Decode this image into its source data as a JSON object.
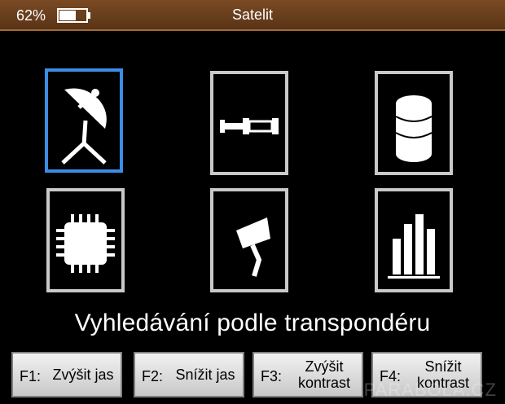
{
  "status": {
    "battery_percent": "62%",
    "battery_level": 0.62,
    "title": "Satelit"
  },
  "tiles": [
    {
      "icon": "satellite-dish-icon",
      "selected": true
    },
    {
      "icon": "telescope-icon",
      "selected": false
    },
    {
      "icon": "database-icon",
      "selected": false
    },
    {
      "icon": "chip-icon",
      "selected": false
    },
    {
      "icon": "camera-icon",
      "selected": false
    },
    {
      "icon": "bar-chart-icon",
      "selected": false
    }
  ],
  "caption": "Vyhledávání podle transpondéru",
  "function_keys": [
    {
      "key": "F1:",
      "label": "Zvýšit jas"
    },
    {
      "key": "F2:",
      "label": "Snížit jas"
    },
    {
      "key": "F3:",
      "label": "Zvýšit kontrast"
    },
    {
      "key": "F4:",
      "label": "Snížit kontrast"
    }
  ],
  "watermark": "PARABOLA.CZ",
  "colors": {
    "status_bar": "#6b3f1e",
    "selection": "#3a8ee6",
    "tile_border": "#c9c9c9"
  }
}
